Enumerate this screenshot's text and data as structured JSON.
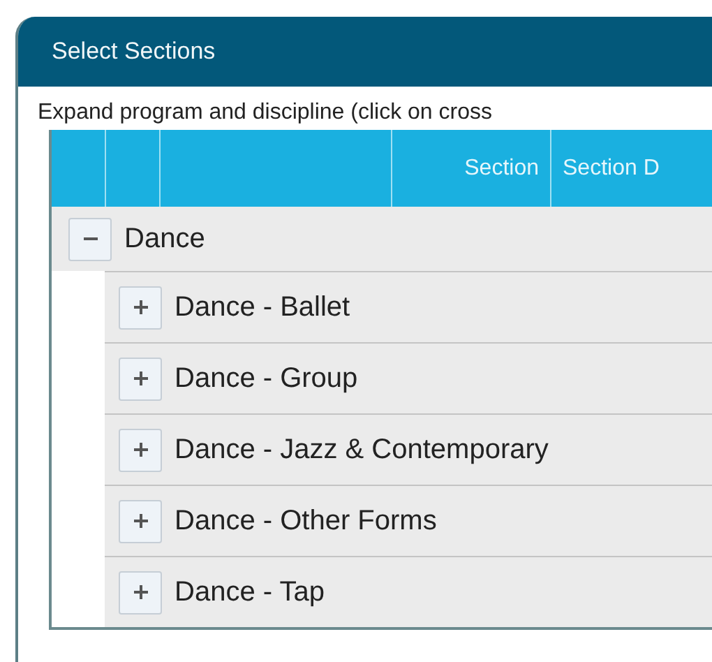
{
  "panel": {
    "title": "Select Sections"
  },
  "instruction": "Expand program and discipline (click on cross",
  "table": {
    "columns": [
      "Section",
      "Section D"
    ],
    "tree": [
      {
        "label": "Dance",
        "expanded": true,
        "children": [
          {
            "label": "Dance - Ballet",
            "expanded": false
          },
          {
            "label": "Dance - Group",
            "expanded": false
          },
          {
            "label": "Dance - Jazz & Contemporary",
            "expanded": false
          },
          {
            "label": "Dance - Other Forms",
            "expanded": false
          },
          {
            "label": "Dance - Tap",
            "expanded": false
          }
        ]
      }
    ]
  }
}
